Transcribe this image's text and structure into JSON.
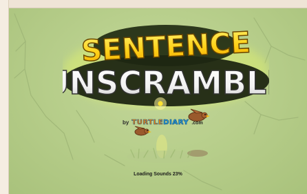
{
  "title": {
    "line1": "SENTENCE",
    "line2": "UNSCRAMBLE"
  },
  "byline": {
    "by": "by",
    "brand_part1": "TURTLE",
    "brand_part2": "DIARY",
    "suffix": ".com"
  },
  "loading": {
    "label": "Loading Sounds",
    "progress_percent": 23,
    "text": "Loading Sounds 23%"
  },
  "colors": {
    "background": "#b8cf8c",
    "title_yellow": "#ffd21a",
    "title_white": "#f2f2f2",
    "brand_orange": "#ff8a00",
    "brand_blue": "#26a8e8"
  },
  "icons": {
    "bird": "brown-bird-icon",
    "firefly": "glowing-firefly-icon"
  }
}
